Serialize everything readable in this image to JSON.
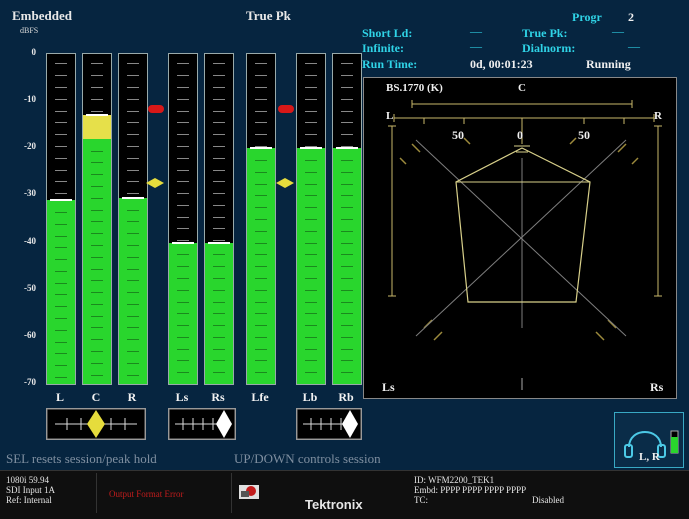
{
  "header": {
    "left_title": "Embedded",
    "unit": "dBFS",
    "center_title": "True Pk",
    "progr_label": "Progr",
    "progr_value": "2"
  },
  "scale_ticks": [
    "0",
    "-10",
    "-20",
    "-30",
    "-40",
    "-50",
    "-60",
    "-70"
  ],
  "meters": [
    {
      "label": "L",
      "level_db": -31,
      "peak_db": -31
    },
    {
      "label": "C",
      "level_db": -18,
      "peak_db": -13,
      "yellow_top_db": -13,
      "yellow_bottom_db": -18
    },
    {
      "label": "R",
      "level_db": -30.5,
      "peak_db": -30.5
    },
    {
      "label": "Ls",
      "level_db": -40,
      "peak_db": -40
    },
    {
      "label": "Rs",
      "level_db": -40,
      "peak_db": -40
    },
    {
      "label": "Lfe",
      "level_db": -20,
      "peak_db": -20
    },
    {
      "label": "Lb",
      "level_db": -20,
      "peak_db": -20
    },
    {
      "label": "Rb",
      "level_db": -20,
      "peak_db": -20
    }
  ],
  "info_panel": {
    "short_ld_label": "Short Ld:",
    "short_ld_value": "—",
    "true_pk_label": "True Pk:",
    "true_pk_value": "—",
    "infinite_label": "Infinite:",
    "infinite_value": "—",
    "dialnorm_label": "Dialnorm:",
    "dialnorm_value": "—",
    "run_time_label": "Run Time:",
    "run_time_value": "0d, 00:01:23",
    "run_state": "Running"
  },
  "surround": {
    "title": "BS.1770 (K)",
    "top_label": "C",
    "left_label": "L",
    "right_label": "R",
    "scale_left": "50",
    "scale_center": "0",
    "scale_right": "50",
    "bottom_left_label": "Ls",
    "bottom_right_label": "Rs"
  },
  "lr_indicator": {
    "label": "L, R"
  },
  "status_bar": {
    "left_message": "SEL resets session/peak hold",
    "right_message": "UP/DOWN controls session"
  },
  "bottom": {
    "format": "1080i 59.94",
    "input": "SDI Input 1A",
    "ref": "Ref: Internal",
    "output_warning": "Output Format Error",
    "brand": "Tektronix",
    "id": "ID: WFM2200_TEK1",
    "embd": "Embd: PPPP PPPP PPPP PPPP",
    "tc_label": "TC:",
    "tc_value": "Disabled"
  },
  "colors": {
    "background": "#062540",
    "meter_green": "#29d62d",
    "meter_yellow": "#e6e04a",
    "accent_cyan": "#2fd3e6",
    "overload_red": "#d81818",
    "marker_yellow": "#e6dc3c"
  }
}
